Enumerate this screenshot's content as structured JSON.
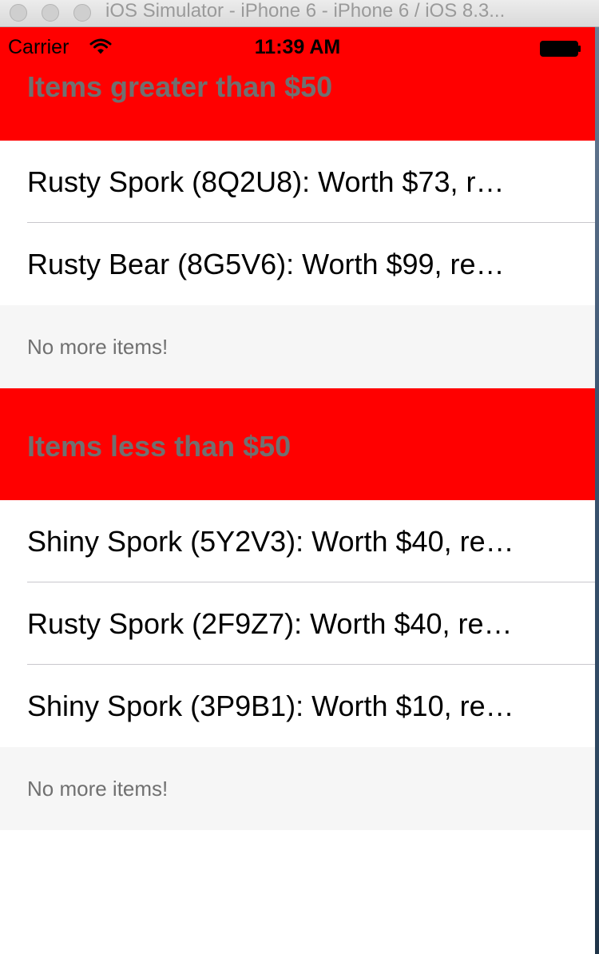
{
  "window": {
    "title": "iOS Simulator - iPhone 6 - iPhone 6 / iOS 8.3..."
  },
  "status_bar": {
    "carrier": "Carrier",
    "time": "11:39 AM",
    "icons": [
      "wifi-icon",
      "battery-icon"
    ]
  },
  "sections": [
    {
      "header": "Items greater than $50",
      "rows": [
        "Rusty Spork (8Q2U8): Worth $73, r…",
        "Rusty Bear (8G5V6): Worth $99, re…"
      ],
      "footer": "No more items!"
    },
    {
      "header": "Items less than $50",
      "rows": [
        "Shiny Spork (5Y2V3): Worth $40, re…",
        "Rusty Spork (2F9Z7): Worth $40, re…",
        "Shiny Spork (3P9B1): Worth $10, re…"
      ],
      "footer": "No more items!"
    }
  ],
  "colors": {
    "section_header_bg": "#ff0000",
    "section_header_text": "#707070",
    "footer_bg": "#f6f6f6"
  }
}
